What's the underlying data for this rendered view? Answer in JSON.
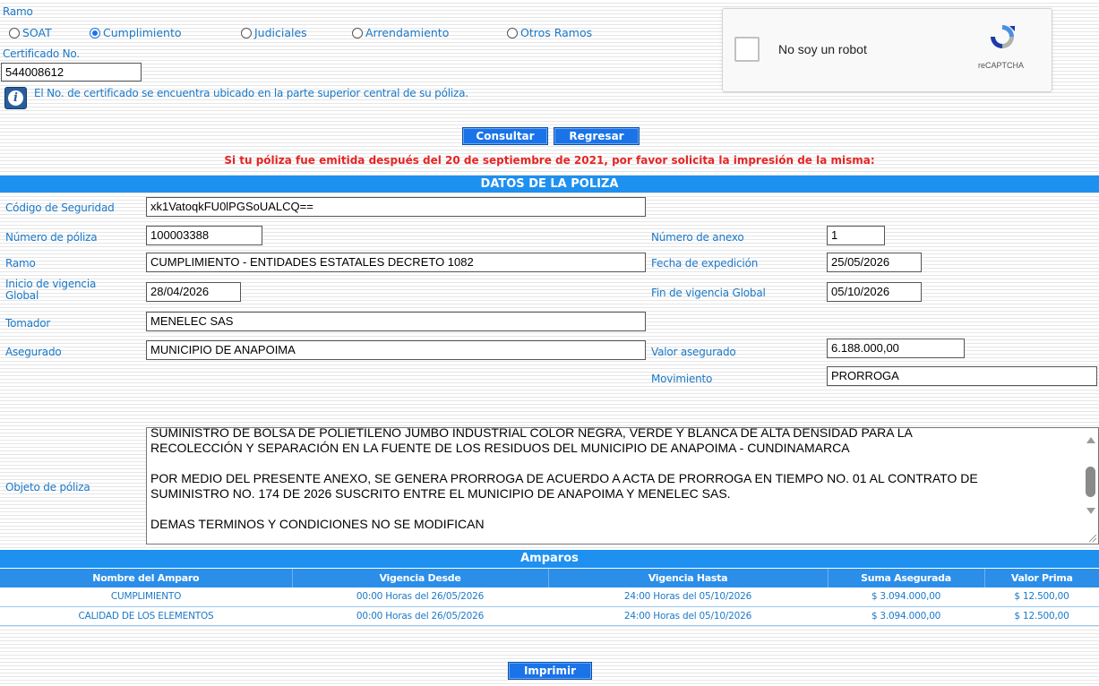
{
  "ramo_heading": "Ramo",
  "ramo_options": [
    {
      "label": "SOAT",
      "selected": false
    },
    {
      "label": "Cumplimiento",
      "selected": true
    },
    {
      "label": "Judiciales",
      "selected": false
    },
    {
      "label": "Arrendamiento",
      "selected": false
    },
    {
      "label": "Otros Ramos",
      "selected": false
    }
  ],
  "certificado_label": "Certificado No.",
  "certificado_value": "544008612",
  "info_icon_glyph": "i",
  "info_text": "El No. de certificado se encuentra ubicado en la parte superior central de su póliza.",
  "captcha": {
    "label": "No soy un robot",
    "brand": "reCAPTCHA"
  },
  "buttons": {
    "consultar": "Consultar",
    "regresar": "Regresar",
    "imprimir": "Imprimir"
  },
  "notice": "Si tu póliza fue emitida después del 20 de septiembre de 2021, por favor solicita la impresión de la misma:",
  "datos_title": "DATOS DE LA POLIZA",
  "poliza": {
    "codigo_label": "Código de Seguridad",
    "codigo_value": "xk1VatoqkFU0lPGSoUALCQ==",
    "numero_label": "Número de póliza",
    "numero_value": "100003388",
    "anexo_label": "Número de anexo",
    "anexo_value": "1",
    "ramo_label": "Ramo",
    "ramo_value": "CUMPLIMIENTO - ENTIDADES ESTATALES DECRETO 1082",
    "expedicion_label": "Fecha de expedición",
    "expedicion_value": "25/05/2026",
    "inicio_label_1": "Inicio de vigencia",
    "inicio_label_2": "Global",
    "inicio_value": "28/04/2026",
    "fin_label": "Fin de vigencia Global",
    "fin_value": "05/10/2026",
    "tomador_label": "Tomador",
    "tomador_value": "MENELEC SAS",
    "asegurado_label": "Asegurado",
    "asegurado_value": "MUNICIPIO DE ANAPOIMA",
    "valor_label": "Valor asegurado",
    "valor_value": "6.188.000,00",
    "movimiento_label": "Movimiento",
    "movimiento_value": "PRORROGA",
    "objeto_label": "Objeto de póliza",
    "objeto_lines": [
      "SUMINISTRO DE BOLSA DE POLIETILENO JUMBO INDUSTRIAL COLOR NEGRA, VERDE Y BLANCA DE ALTA DENSIDAD PARA LA",
      "RECOLECCIÓN Y SEPARACIÓN EN LA FUENTE DE LOS RESIDUOS DEL MUNICIPIO DE ANAPOIMA -  CUNDINAMARCA",
      "POR MEDIO DEL PRESENTE ANEXO, SE GENERA PRORROGA DE ACUERDO A ACTA DE PRORROGA EN TIEMPO NO. 01 AL CONTRATO DE",
      "SUMINISTRO NO. 174 DE 2026 SUSCRITO ENTRE EL MUNICIPIO DE ANAPOIMA Y MENELEC SAS.",
      "DEMAS TERMINOS Y CONDICIONES NO SE MODIFICAN"
    ]
  },
  "amparos": {
    "title": "Amparos",
    "headers": [
      "Nombre del Amparo",
      "Vigencia Desde",
      "Vigencia Hasta",
      "Suma Asegurada",
      "Valor Prima"
    ],
    "rows": [
      [
        "CUMPLIMIENTO",
        "00:00 Horas del 26/05/2026",
        "24:00 Horas del 05/10/2026",
        "$ 3.094.000,00",
        "$ 12.500,00"
      ],
      [
        "CALIDAD DE LOS ELEMENTOS",
        "00:00 Horas del 26/05/2026",
        "24:00 Horas del 05/10/2026",
        "$ 3.094.000,00",
        "$ 12.500,00"
      ]
    ]
  }
}
